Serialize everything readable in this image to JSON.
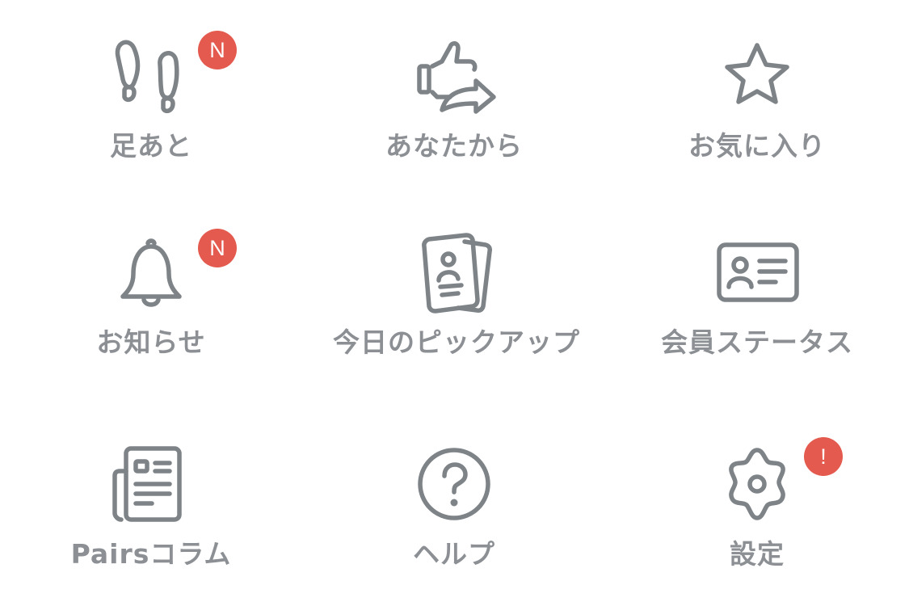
{
  "menu": {
    "items": [
      {
        "label": "足あと",
        "icon": "footprints-icon",
        "badge": "N"
      },
      {
        "label": "あなたから",
        "icon": "thumbs-up-share-icon",
        "badge": ""
      },
      {
        "label": "お気に入り",
        "icon": "star-icon",
        "badge": ""
      },
      {
        "label": "お知らせ",
        "icon": "bell-icon",
        "badge": "N"
      },
      {
        "label": "今日のピックアップ",
        "icon": "profile-cards-icon",
        "badge": ""
      },
      {
        "label": "会員ステータス",
        "icon": "id-card-icon",
        "badge": ""
      },
      {
        "label": "Pairsコラム",
        "icon": "newspaper-icon",
        "badge": ""
      },
      {
        "label": "ヘルプ",
        "icon": "question-circle-icon",
        "badge": ""
      },
      {
        "label": "設定",
        "icon": "gear-icon",
        "badge": "!"
      }
    ]
  },
  "colors": {
    "icon": "#7e8388",
    "label": "#8c8f93",
    "badge": "#e45a4f",
    "background": "#ffffff"
  }
}
